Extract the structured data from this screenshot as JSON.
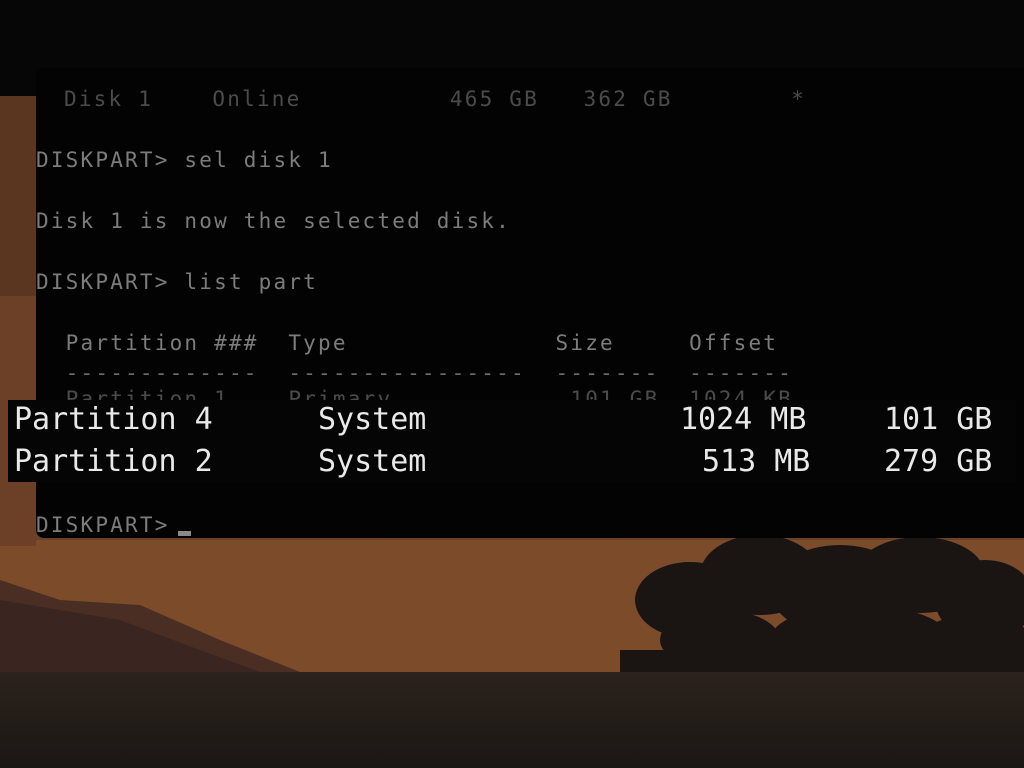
{
  "terminal": {
    "lines": {
      "disk_row": "Disk 1    Online          465 GB   362 GB        *",
      "cmd_select": "DISKPART> sel disk 1",
      "msg_selected": "Disk 1 is now the selected disk.",
      "cmd_list": "DISKPART> list part",
      "col_header": "  Partition ###  Type              Size     Offset",
      "col_rule": "  -------------  ----------------  -------  -------",
      "part1_row": "  Partition 1    Primary            101 GB  1024 KB",
      "prompt": "DISKPART> "
    }
  },
  "highlight": {
    "rows": [
      {
        "partition": "Partition 4",
        "type": "System",
        "size": "1024 MB",
        "offset": "101 GB"
      },
      {
        "partition": "Partition 2",
        "type": "System",
        "size": "513 MB",
        "offset": "279 GB"
      }
    ]
  },
  "colors": {
    "terminal_bg": "#030303",
    "terminal_text": "#7c7c7c",
    "highlight_text": "#e9e9e9",
    "wallpaper_accent": "#7a4a2a"
  }
}
